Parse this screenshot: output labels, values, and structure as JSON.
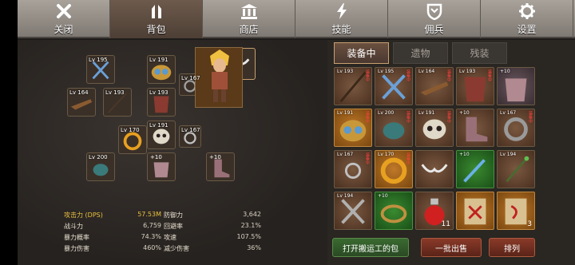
{
  "nav": {
    "tabs": [
      {
        "label": "关闭",
        "icon": "close-icon",
        "active": false
      },
      {
        "label": "背包",
        "icon": "backpack-icon",
        "active": true
      },
      {
        "label": "商店",
        "icon": "shop-icon",
        "active": false
      },
      {
        "label": "技能",
        "icon": "lightning-icon",
        "active": false
      },
      {
        "label": "佣兵",
        "icon": "mercenary-shield-icon",
        "active": false
      },
      {
        "label": "设置",
        "icon": "gear-icon",
        "active": false
      }
    ]
  },
  "equipped": [
    {
      "name": "crossed-swords",
      "level": "Lv 195"
    },
    {
      "name": "goggles-helmet",
      "level": "Lv 191"
    },
    {
      "name": "horn-necklace",
      "level": ""
    },
    {
      "name": "rifle",
      "level": "Lv 164"
    },
    {
      "name": "spear",
      "level": "Lv 193"
    },
    {
      "name": "leather-armor",
      "level": "Lv 193"
    },
    {
      "name": "ring",
      "level": "Lv 167"
    },
    {
      "name": "gold-ring",
      "level": "Lv 170"
    },
    {
      "name": "skull-mask",
      "level": "Lv 191"
    },
    {
      "name": "silver-ring",
      "level": "Lv 167"
    },
    {
      "name": "beetle-gloves",
      "level": "Lv 200"
    },
    {
      "name": "pink-armor",
      "plus": "+10"
    },
    {
      "name": "boots",
      "plus": "+10"
    }
  ],
  "stats": [
    [
      {
        "name": "攻击力 (DPS)",
        "value": "57.53M",
        "highlight": true
      },
      {
        "name": "防御力",
        "value": "3,642"
      }
    ],
    [
      {
        "name": "战斗力",
        "value": "6,759"
      },
      {
        "name": "回避率",
        "value": "23.1%"
      }
    ],
    [
      {
        "name": "暴力概率",
        "value": "74.3%"
      },
      {
        "name": "攻速",
        "value": "107.5%"
      }
    ],
    [
      {
        "name": "暴力伤害",
        "value": "460%"
      },
      {
        "name": "减少伤害",
        "value": "36%"
      }
    ]
  ],
  "inventory": {
    "tabs": [
      {
        "label": "装备中",
        "active": true
      },
      {
        "label": "遗物",
        "active": false
      },
      {
        "label": "残装",
        "active": false
      }
    ],
    "tag_text": "装备中",
    "items": [
      {
        "name": "spear",
        "level": "Lv 193",
        "tagged": true,
        "bg": "brown"
      },
      {
        "name": "crossed-swords",
        "level": "Lv 195",
        "tagged": true,
        "bg": "brown"
      },
      {
        "name": "rifle",
        "level": "Lv 164",
        "tagged": true,
        "bg": "brown"
      },
      {
        "name": "leather-armor",
        "level": "Lv 193",
        "tagged": true,
        "bg": "brown"
      },
      {
        "name": "pink-armor",
        "level": "+10",
        "tagged": false,
        "bg": "mauve"
      },
      {
        "name": "goggles-helmet",
        "level": "Lv 191",
        "tagged": true,
        "bg": "orange"
      },
      {
        "name": "beetle-gloves",
        "level": "Lv 200",
        "tagged": true,
        "bg": "brown"
      },
      {
        "name": "skull-mask",
        "level": "Lv 191",
        "tagged": true,
        "bg": "brown"
      },
      {
        "name": "boots",
        "level": "+10",
        "tagged": false,
        "bg": "brown"
      },
      {
        "name": "silver-ring",
        "level": "Lv 167",
        "tagged": true,
        "bg": "brown"
      },
      {
        "name": "ring",
        "level": "Lv 167",
        "tagged": true,
        "bg": "brown"
      },
      {
        "name": "gold-ring",
        "level": "Lv 170",
        "tagged": true,
        "bg": "orange"
      },
      {
        "name": "horn-necklace",
        "level": "",
        "tagged": false,
        "bg": "brown"
      },
      {
        "name": "blue-sword",
        "level": "+10",
        "tagged": false,
        "bg": "green"
      },
      {
        "name": "green-staff",
        "level": "Lv 194",
        "tagged": false,
        "bg": "brown"
      },
      {
        "name": "crossed-swords-2",
        "level": "Lv 194",
        "tagged": false,
        "bg": "brown"
      },
      {
        "name": "green-belt",
        "level": "+10",
        "tagged": false,
        "bg": "green"
      },
      {
        "name": "red-potion",
        "level": "",
        "qty": "11",
        "bg": "brown"
      },
      {
        "name": "scroll-red",
        "level": "",
        "qty": "",
        "bg": "orange"
      },
      {
        "name": "scroll-red-2",
        "level": "",
        "qty": "3",
        "bg": "orange"
      }
    ]
  },
  "buttons": {
    "porter": "打开搬运工的包",
    "sell": "一批出售",
    "sort": "排列"
  },
  "colors": {
    "gold": "#e8c040",
    "accent": "#c8a070",
    "active_tab": "#6a5040",
    "green_btn": "#3a6a30",
    "red_btn": "#8a3a28"
  }
}
